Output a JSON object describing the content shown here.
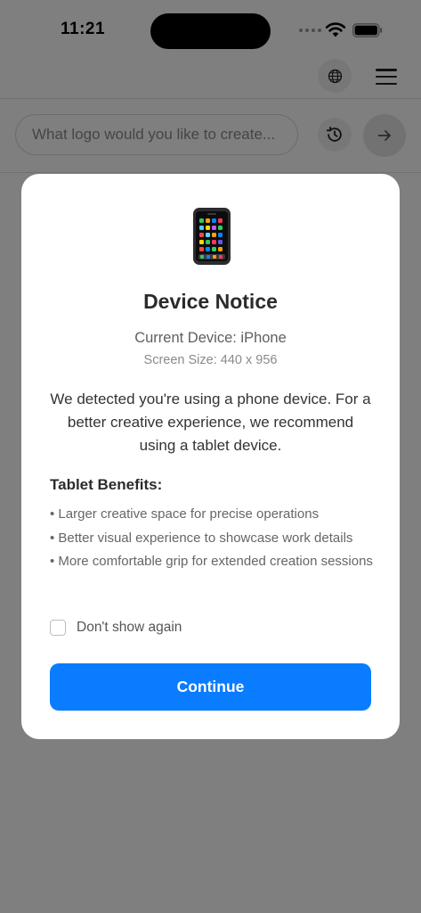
{
  "status_bar": {
    "time": "11:21"
  },
  "search": {
    "placeholder": "What logo would you like to create..."
  },
  "modal": {
    "title": "Device Notice",
    "current_device": "Current Device: iPhone",
    "screen_size": "Screen Size: 440 x 956",
    "description": "We detected you're using a phone device. For a better creative experience, we recommend using a tablet device.",
    "benefits_title": "Tablet Benefits:",
    "benefits": [
      "Larger creative space for precise operations",
      "Better visual experience to showcase work details",
      "More comfortable grip for extended creation sessions"
    ],
    "dont_show_again": "Don't show again",
    "dont_show_again_checked": false,
    "continue_label": "Continue"
  },
  "icons": {
    "header": [
      "globe-icon",
      "menu-icon"
    ],
    "search_row": [
      "history-icon",
      "arrow-right-icon"
    ],
    "modal": "mobile-phone-icon"
  },
  "colors": {
    "primary": "#0a7cff",
    "overlay": "rgba(0,0,0,0.5)",
    "title_text": "#2b2b2b"
  }
}
